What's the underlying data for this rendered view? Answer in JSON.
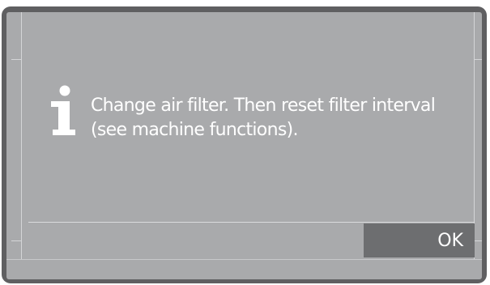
{
  "dialog": {
    "icon": "info-icon",
    "message": "Change air filter. Then reset filter interval (see machine functions).",
    "ok_label": "OK"
  },
  "colors": {
    "bezel": "#5f5f61",
    "screen": "#a9aaac",
    "button": "#6d6e70",
    "text": "#ffffff"
  }
}
